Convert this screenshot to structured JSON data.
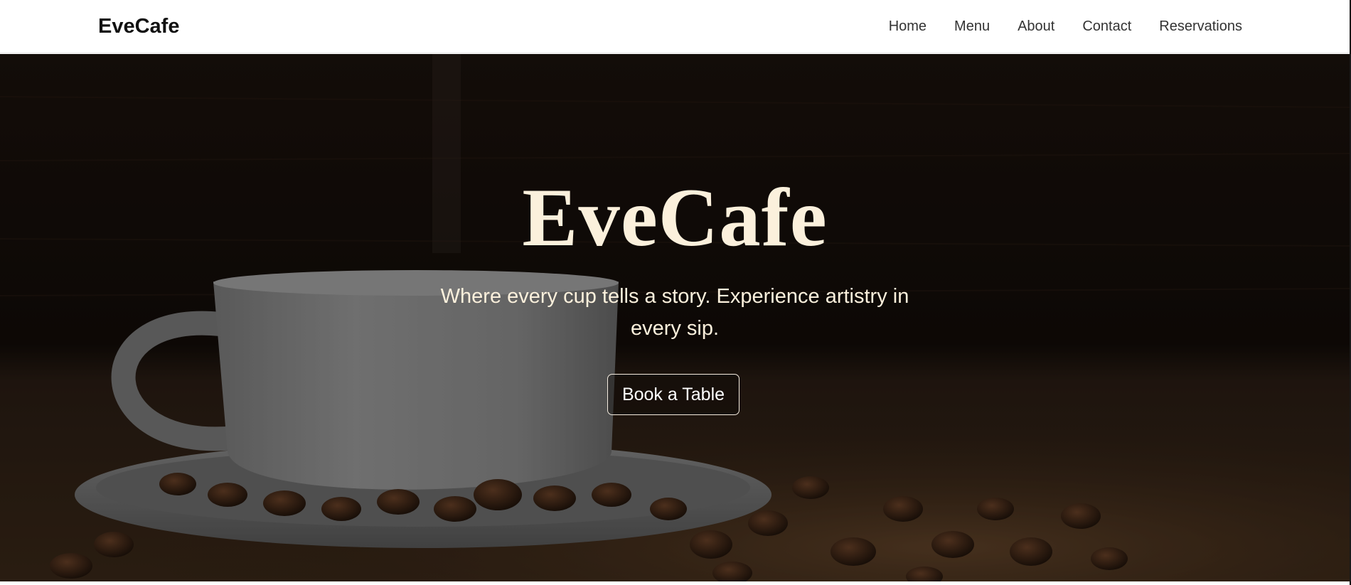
{
  "header": {
    "brand": "EveCafe",
    "nav": [
      {
        "label": "Home"
      },
      {
        "label": "Menu"
      },
      {
        "label": "About"
      },
      {
        "label": "Contact"
      },
      {
        "label": "Reservations"
      }
    ]
  },
  "hero": {
    "title": "EveCafe",
    "tagline": "Where every cup tells a story. Experience artistry in every sip.",
    "cta_label": "Book a Table",
    "background_image": "coffee-cup-with-beans-photo"
  },
  "colors": {
    "hero_text": "#fbf0dc",
    "nav_text": "#333333",
    "brand_text": "#111111",
    "button_border": "#f4ece0"
  }
}
